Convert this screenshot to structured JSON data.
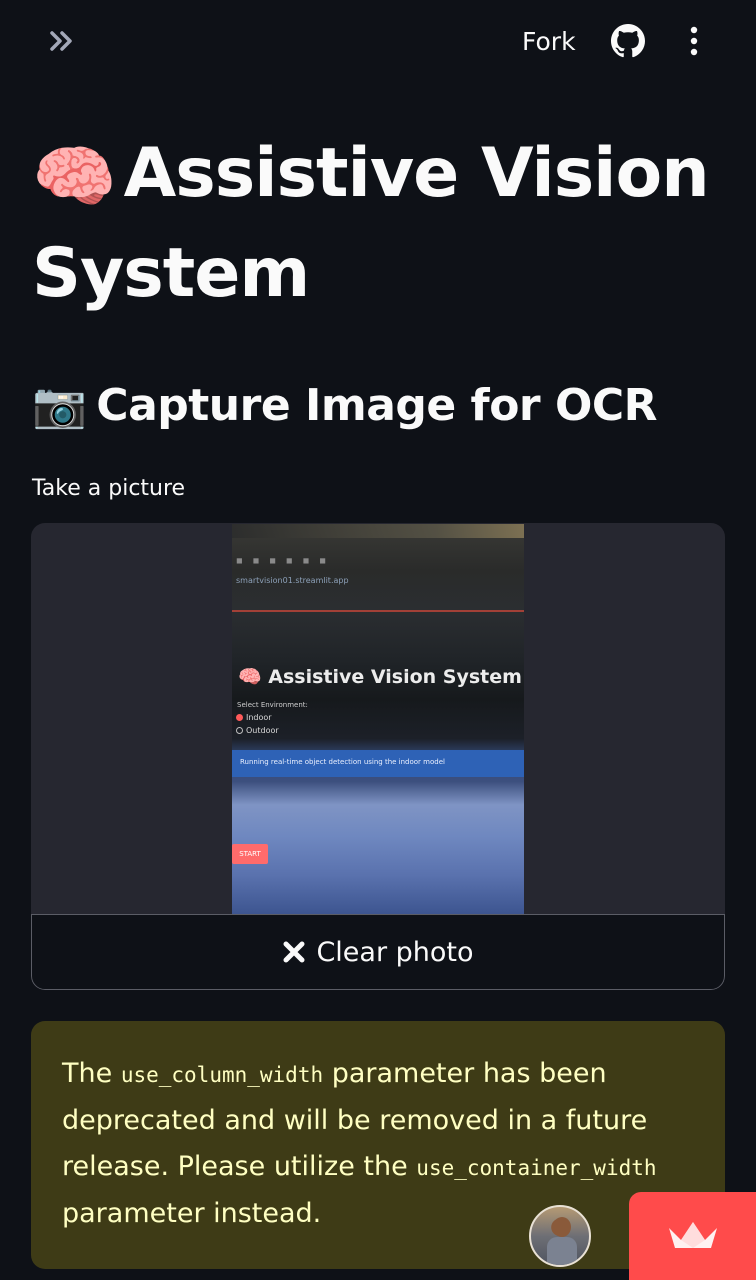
{
  "header": {
    "fork_label": "Fork",
    "expand_icon": "double-chevron-right-icon",
    "github_icon": "github-icon",
    "menu_icon": "vertical-ellipsis-icon"
  },
  "main": {
    "title_emoji": "🧠",
    "title": "Assistive Vision System",
    "subheader_emoji": "📷",
    "subheader": "Capture Image for OCR",
    "camera_label": "Take a picture",
    "photo": {
      "app_title": "🧠 Assistive Vision System",
      "env_label": "Select Environment:",
      "option_indoor": "Indoor",
      "option_outdoor": "Outdoor",
      "info_text": "Running real-time object detection using the indoor model",
      "start_label": "START",
      "url_text": "smartvision01.streamlit.app"
    },
    "clear_button_label": "Clear photo",
    "warning": {
      "text_1": "The ",
      "code_1": "use_column_width",
      "text_2": " parameter has been deprecated and will be removed in a future release. Please utilize the ",
      "code_2": "use_container_width",
      "text_3": " parameter instead."
    }
  },
  "colors": {
    "background": "#0e1117",
    "widget": "#262730",
    "warning_bg": "#3e3b16",
    "warning_text": "#ffffc2",
    "accent": "#ff4b4b"
  }
}
